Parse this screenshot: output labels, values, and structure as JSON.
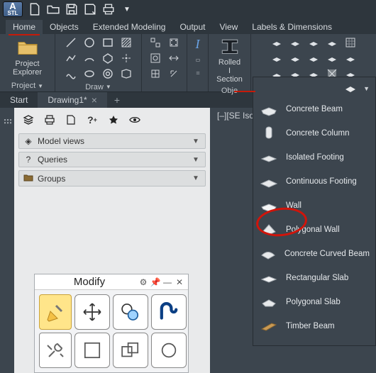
{
  "logo_sub": "STL",
  "menu": [
    "Home",
    "Objects",
    "Extended Modeling",
    "Output",
    "View",
    "Labels & Dimensions"
  ],
  "menu_active_index": 0,
  "ribbon": {
    "project_explorer": "Project\nExplorer",
    "rolled": "Rolled\nI Section",
    "panel_titles": [
      "Project",
      "Draw",
      "Obje"
    ]
  },
  "doc_tabs": {
    "start": "Start",
    "drawing": "Drawing1*"
  },
  "view_label": "[–][SE Isome",
  "left_toolbar_icons": [
    "layers",
    "printer",
    "page",
    "help",
    "star",
    "eye"
  ],
  "sections": [
    {
      "icon": "◈",
      "label": "Model views"
    },
    {
      "icon": "?",
      "label": "Queries"
    },
    {
      "icon": "📁",
      "label": "Groups"
    }
  ],
  "modify": {
    "title": "Modify"
  },
  "objects_menu": [
    "Concrete  Beam",
    "Concrete  Column",
    "Isolated  Footing",
    "Continuous  Footing",
    "Wall",
    "Polygonal  Wall",
    "Concrete  Curved Beam",
    "Rectangular  Slab",
    "Polygonal  Slab",
    "Timber  Beam"
  ],
  "highlighted_index": 4
}
